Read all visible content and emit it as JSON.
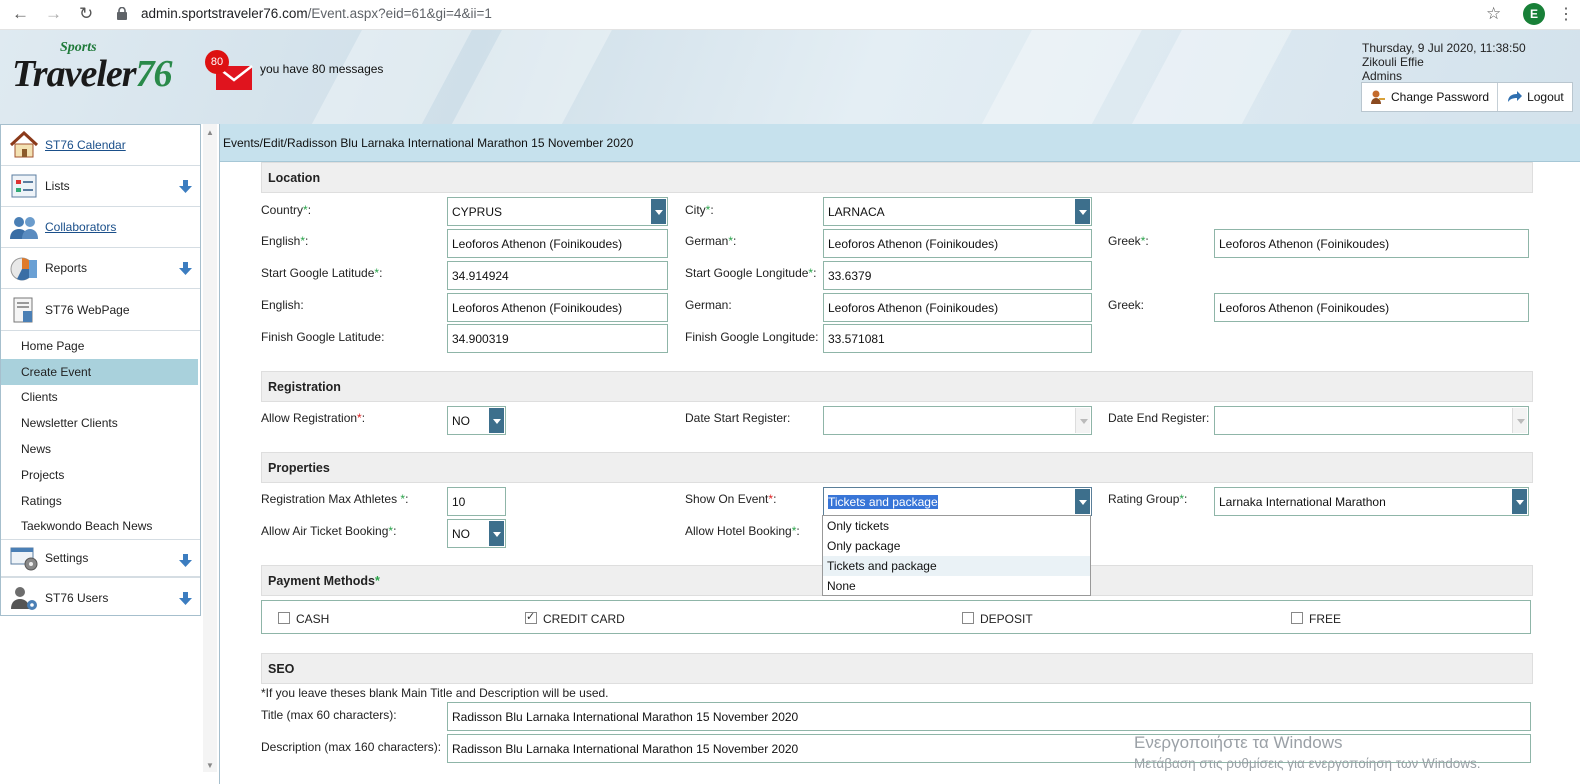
{
  "browser": {
    "url_domain": "admin.sportstraveler76.com",
    "url_path": "/Event.aspx?eid=61&gi=4&ii=1",
    "profile_initial": "E"
  },
  "header": {
    "logo_top": "Sports",
    "logo_main": "Traveler",
    "logo_num": "76",
    "message_count": "80",
    "message_text": "you have 80 messages",
    "date_line": "Thursday, 9 Jul 2020, 11:38:50",
    "user_name": "Zikouli Effie",
    "user_role": "Admins",
    "change_password": "Change Password",
    "logout": "Logout"
  },
  "sidebar": {
    "items": [
      {
        "label": "ST76 Calendar",
        "icon": "home-icon"
      },
      {
        "label": "Lists",
        "icon": "list-icon"
      },
      {
        "label": "Collaborators",
        "icon": "users-icon"
      },
      {
        "label": "Reports",
        "icon": "chart-icon"
      },
      {
        "label": "ST76 WebPage",
        "icon": "webpage-icon"
      }
    ],
    "subitems": [
      "Home Page",
      "Create Event",
      "Clients",
      "Newsletter Clients",
      "News",
      "Projects",
      "Ratings",
      "Taekwondo Beach News"
    ],
    "bottom": [
      {
        "label": "Settings",
        "icon": "settings-icon"
      },
      {
        "label": "ST76 Users",
        "icon": "user-settings-icon"
      }
    ]
  },
  "breadcrumb": "Events/Edit/Radisson Blu Larnaka International Marathon 15 November 2020",
  "location": {
    "title": "Location",
    "country_label": "Country",
    "country_value": "CYPRUS",
    "city_label": "City",
    "city_value": "LARNACA",
    "english_label": "English",
    "english_value": "Leoforos Athenon (Foinikoudes)",
    "german_label": "German",
    "german_value": "Leoforos Athenon (Foinikoudes)",
    "greek_label": "Greek",
    "greek_value": "Leoforos Athenon (Foinikoudes)",
    "start_lat_label": "Start Google Latitude",
    "start_lat_value": "34.914924",
    "start_lng_label": "Start Google Longitude",
    "start_lng_value": "33.6379",
    "english2_label": "English:",
    "english2_value": "Leoforos Athenon (Foinikoudes)",
    "german2_label": "German:",
    "german2_value": "Leoforos Athenon (Foinikoudes)",
    "greek2_label": "Greek:",
    "greek2_value": "Leoforos Athenon (Foinikoudes)",
    "finish_lat_label": "Finish Google Latitude:",
    "finish_lat_value": "34.900319",
    "finish_lng_label": "Finish Google Longitude:",
    "finish_lng_value": "33.571081"
  },
  "registration": {
    "title": "Registration",
    "allow_label": "Allow Registration",
    "allow_value": "NO",
    "date_start_label": "Date Start Register:",
    "date_start_value": "",
    "date_end_label": "Date End Register:",
    "date_end_value": ""
  },
  "properties": {
    "title": "Properties",
    "max_label": "Registration Max Athletes ",
    "max_value": "10",
    "show_label": "Show On Event",
    "show_value": "Tickets and package",
    "rating_label": "Rating Group",
    "rating_value": "Larnaka International Marathon",
    "air_label": "Allow Air Ticket Booking",
    "air_value": "NO",
    "hotel_label": "Allow Hotel Booking",
    "show_options": [
      "Only tickets",
      "Only package",
      "Tickets and package",
      "None"
    ]
  },
  "payment": {
    "title": "Payment Methods",
    "methods": [
      {
        "label": "CASH",
        "checked": false
      },
      {
        "label": "CREDIT CARD",
        "checked": true
      },
      {
        "label": "DEPOSIT",
        "checked": false
      },
      {
        "label": "FREE",
        "checked": false
      }
    ]
  },
  "seo": {
    "title": "SEO",
    "note": "*If you leave theses blank Main Title and Description will be used.",
    "title_label": "Title (max 60 characters):",
    "title_value": "Radisson Blu Larnaka International Marathon 15 November 2020",
    "desc_label": "Description (max 160 characters):",
    "desc_value": "Radisson Blu Larnaka International Marathon 15 November 2020"
  },
  "req_mark": "*",
  "watermark": {
    "line1": "Ενεργοποιήστε τα Windows",
    "line2": "Μετάβαση στις ρυθμίσεις για ενεργοποίηση των Windows."
  },
  "colors": {
    "accent": "#3d6f8c",
    "breadcrumb_bg": "#c6e1ed",
    "active_menu": "#a9d1dc",
    "required_green": "#2aa34a",
    "required_red": "#d22"
  }
}
